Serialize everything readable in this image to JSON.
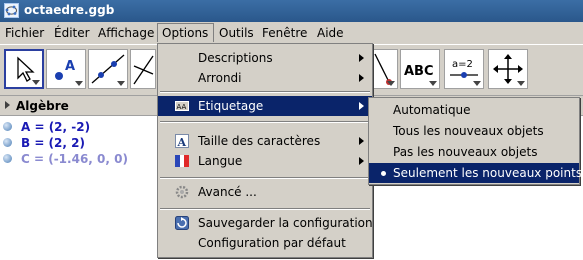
{
  "window": {
    "title": "octaedre.ggb"
  },
  "menubar": {
    "items": [
      "Fichier",
      "Éditer",
      "Affichage",
      "Options",
      "Outils",
      "Fenêtre",
      "Aide"
    ],
    "active": "Options"
  },
  "toolbar": {
    "tools": [
      {
        "icon": "move-arrow-icon",
        "selected": true
      },
      {
        "icon": "point-icon",
        "label": "A"
      },
      {
        "icon": "line-through-points-icon"
      },
      {
        "icon": "perpendicular-line-icon"
      },
      {
        "icon": "reflect-line-icon"
      },
      {
        "icon": "text-tool-icon",
        "label": "ABC"
      },
      {
        "icon": "slider-tool-icon",
        "label": "a=2"
      },
      {
        "icon": "move-graphics-view-icon"
      }
    ]
  },
  "algebra": {
    "header": "Algèbre",
    "rows": [
      {
        "text": "A = (2, -2)",
        "auxiliary": false
      },
      {
        "text": "B = (2, 2)",
        "auxiliary": false
      },
      {
        "text": "C = (-1.46, 0, 0)",
        "auxiliary": true
      }
    ]
  },
  "options_menu": {
    "items": [
      {
        "label": "Descriptions",
        "submenu": true
      },
      {
        "label": "Arrondi",
        "submenu": true
      },
      {
        "label": "Etiquetage",
        "submenu": true,
        "highlighted": true,
        "icon": "labeling-icon"
      },
      {
        "label": "Taille des caractères",
        "submenu": true,
        "icon": "font-size-icon"
      },
      {
        "label": "Langue",
        "submenu": true,
        "icon": "flag-icon"
      },
      {
        "label": "Avancé ...",
        "submenu": false,
        "icon": "gear-icon"
      },
      {
        "label": "Sauvegarder la configuration",
        "submenu": false,
        "icon": "save-settings-icon"
      },
      {
        "label": "Configuration par défaut",
        "submenu": false
      }
    ]
  },
  "labeling_submenu": {
    "items": [
      {
        "label": "Automatique",
        "selected": false
      },
      {
        "label": "Tous les nouveaux objets",
        "selected": false
      },
      {
        "label": "Pas les nouveaux objets",
        "selected": false
      },
      {
        "label": "Seulement les nouveaux points",
        "selected": true
      }
    ]
  },
  "colors": {
    "highlight": "#0a246a",
    "titlebar": "#2a578b",
    "algebra_text": "#1a1ab4"
  }
}
